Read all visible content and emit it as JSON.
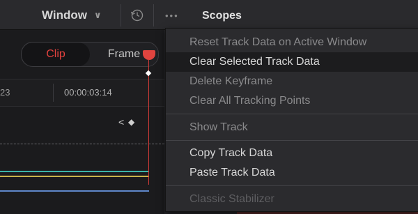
{
  "topbar": {
    "window_label": "Window",
    "window_chevron": "∨",
    "history_icon": "history-icon",
    "more_icon": "•••",
    "scopes_label": "Scopes"
  },
  "left_panel": {
    "segment": {
      "clip_label": "Clip",
      "frame_label": "Frame",
      "selected": "Clip"
    },
    "ruler": {
      "prev_tick": "23",
      "time": "00:00:03:14"
    },
    "nav": {
      "prev_symbol": "<",
      "keyframe_symbol": "◆"
    },
    "curve_colors": {
      "teal": "#3bb4a8",
      "yellow": "#c9b34a",
      "blue": "#5f87c9"
    },
    "playhead_color": "#e0443f"
  },
  "context_menu": {
    "items": [
      {
        "label": "Reset Track Data on Active Window",
        "state": "disabled"
      },
      {
        "label": "Clear Selected Track Data",
        "state": "highlighted"
      },
      {
        "label": "Delete Keyframe",
        "state": "disabled"
      },
      {
        "label": "Clear All Tracking Points",
        "state": "disabled"
      },
      {
        "label": "Show Track",
        "state": "disabled"
      },
      {
        "label": "Copy Track Data",
        "state": "enabled"
      },
      {
        "label": "Paste Track Data",
        "state": "enabled"
      },
      {
        "label": "Classic Stabilizer",
        "state": "disabled"
      }
    ]
  }
}
